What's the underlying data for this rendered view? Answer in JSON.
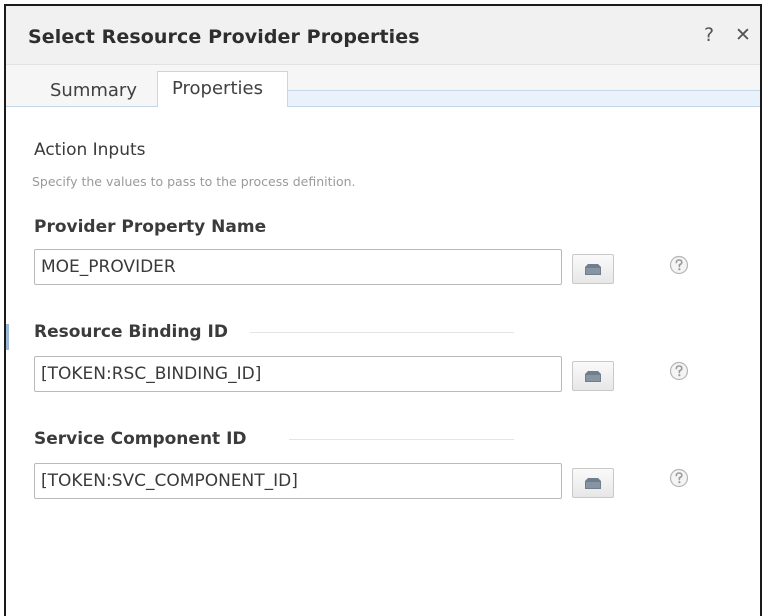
{
  "dialog": {
    "title": "Select Resource Provider Properties",
    "help_button": "?",
    "close_button": "✕"
  },
  "tabs": [
    {
      "label": "Summary",
      "active": false
    },
    {
      "label": "Properties",
      "active": true
    }
  ],
  "section": {
    "title": "Action Inputs",
    "description": "Specify the values to pass to the process definition."
  },
  "fields": [
    {
      "label": "Provider Property Name",
      "value": "MOE_PROVIDER",
      "browse_icon": "folder-icon",
      "help_icon": "help-icon"
    },
    {
      "label": "Resource Binding ID",
      "value": "[TOKEN:RSC_BINDING_ID]",
      "browse_icon": "folder-icon",
      "help_icon": "help-icon"
    },
    {
      "label": "Service Component ID",
      "value": "[TOKEN:SVC_COMPONENT_ID]",
      "browse_icon": "folder-icon",
      "help_icon": "help-icon"
    }
  ],
  "colors": {
    "tab_border": "#c4d6e8",
    "tab_strip": "#e9f1fa",
    "title_bar": "#f1f1f1"
  }
}
